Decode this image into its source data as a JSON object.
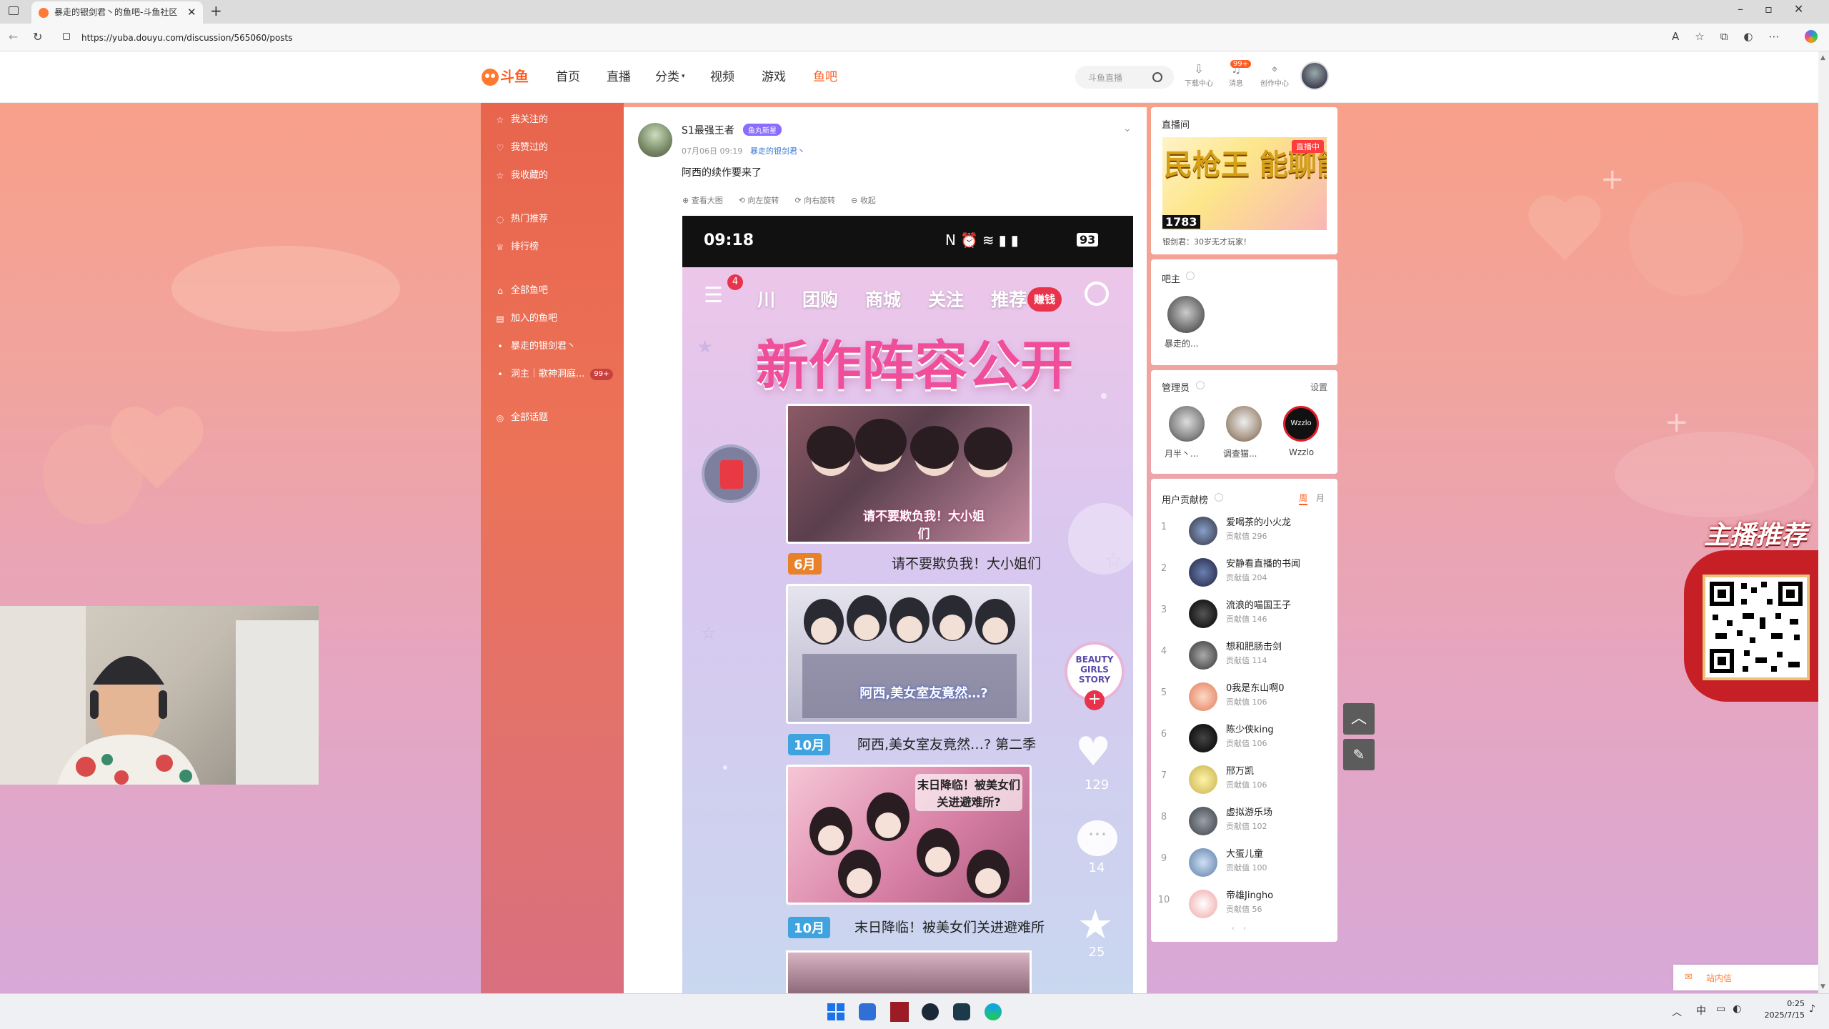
{
  "browser": {
    "tab_title": "暴走的银剑君丶的鱼吧-斗鱼社区",
    "url": "https://yuba.douyu.com/discussion/565060/posts"
  },
  "site": {
    "logo_text": "斗鱼",
    "nav": [
      "首页",
      "直播",
      "分类",
      "视频",
      "游戏",
      "鱼吧"
    ],
    "search_placeholder": "斗鱼直播",
    "actions": [
      "下载中心",
      "消息",
      "创作中心"
    ],
    "message_badge": "99+",
    "colors": {
      "brand": "#ff5d23",
      "sidebar": "#e8644d"
    }
  },
  "sidebar": {
    "items": [
      "我关注的",
      "我赞过的",
      "我收藏的",
      "热门推荐",
      "排行榜",
      "全部鱼吧",
      "加入的鱼吧",
      "暴走的银剑君丶",
      "洞主｜歌神洞庭...",
      "全部话题"
    ],
    "badge": "99+"
  },
  "post": {
    "author": "S1最强王者",
    "level_badge": "鱼丸新星",
    "time": "07月06日 09:19",
    "group": "暴走的银剑君丶",
    "content": "阿西的续作要来了",
    "tools": [
      "查看大图",
      "向左旋转",
      "向右旋转",
      "收起"
    ]
  },
  "phone": {
    "time": "09:18",
    "battery": "93",
    "tabs": [
      "川",
      "团购",
      "商城",
      "关注",
      "推荐"
    ],
    "menu_badge": "4",
    "earn_label": "赚钱",
    "banner_title": "新作阵容公开",
    "films": [
      {
        "month": "6月",
        "poster_text": "请不要欺负我！大小姐们",
        "caption": "请不要欺负我！大小姐们"
      },
      {
        "month": "10月",
        "poster_text": "阿西,美女室友竟然…?",
        "caption": "阿西,美女室友竟然…?  第二季"
      },
      {
        "month": "10月",
        "poster_text": "末日降临！被美女们关进避难所?",
        "caption": "末日降临！被美女们关进避难所"
      }
    ],
    "side_logo": "BEAUTY GIRLS STORY",
    "counts": {
      "like": "129",
      "comment": "14",
      "fav": "25"
    }
  },
  "live": {
    "title": "直播间",
    "live_badge": "直播中",
    "thumb_text": "民枪王 能聊能打",
    "rank_badge": "1783",
    "caption": "银剑君：30岁无才玩家！"
  },
  "owner": {
    "title": "吧主",
    "name": "暴走的..."
  },
  "admins": {
    "title": "管理员",
    "settings": "设置",
    "list": [
      "月半丶...",
      "调查猫...",
      "Wzzlo"
    ]
  },
  "ranking": {
    "title": "用户贡献榜",
    "tabs": [
      "周",
      "月"
    ],
    "entries": [
      {
        "rank": "1",
        "name": "爱喝茶的小火龙",
        "score": "贡献值 296"
      },
      {
        "rank": "2",
        "name": "安静看直播的书闻",
        "score": "贡献值 204"
      },
      {
        "rank": "3",
        "name": "流浪的喵国王子",
        "score": "贡献值 146"
      },
      {
        "rank": "4",
        "name": "想和肥肠击剑",
        "score": "贡献值 114"
      },
      {
        "rank": "5",
        "name": "0我是东山啊0",
        "score": "贡献值 106"
      },
      {
        "rank": "6",
        "name": "陈少侠king",
        "score": "贡献值 106"
      },
      {
        "rank": "7",
        "name": "邢万凯",
        "score": "贡献值 106"
      },
      {
        "rank": "8",
        "name": "虚拟游乐场",
        "score": "贡献值 102"
      },
      {
        "rank": "9",
        "name": "大蛋儿童",
        "score": "贡献值 100"
      },
      {
        "rank": "10",
        "name": "帝雄Jingho",
        "score": "贡献值 56"
      }
    ]
  },
  "float": {
    "banner": "主播推荐",
    "letter": "站内信"
  },
  "taskbar": {
    "ime": "中",
    "time": "0:25",
    "date": "2025/7/15"
  }
}
